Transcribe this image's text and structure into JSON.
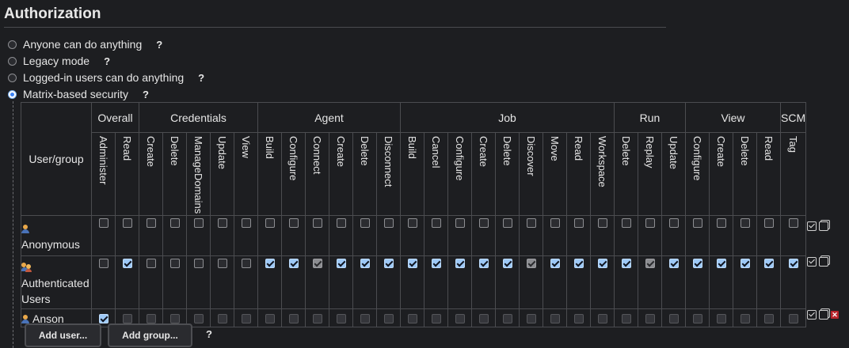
{
  "section": {
    "title": "Authorization"
  },
  "strategies": [
    {
      "label": "Anyone can do anything",
      "help": "?",
      "selected": false
    },
    {
      "label": "Legacy mode",
      "help": "?",
      "selected": false
    },
    {
      "label": "Logged-in users can do anything",
      "help": "?",
      "selected": false
    },
    {
      "label": "Matrix-based security",
      "help": "?",
      "selected": true
    }
  ],
  "matrix": {
    "user_group_header": "User/group",
    "groups": [
      {
        "label": "Overall",
        "permissions": [
          "Administer",
          "Read"
        ]
      },
      {
        "label": "Credentials",
        "permissions": [
          "Create",
          "Delete",
          "ManageDomains",
          "Update",
          "View"
        ]
      },
      {
        "label": "Agent",
        "permissions": [
          "Build",
          "Configure",
          "Connect",
          "Create",
          "Delete",
          "Disconnect"
        ]
      },
      {
        "label": "Job",
        "permissions": [
          "Build",
          "Cancel",
          "Configure",
          "Create",
          "Delete",
          "Discover",
          "Move",
          "Read",
          "Workspace"
        ]
      },
      {
        "label": "Run",
        "permissions": [
          "Delete",
          "Replay",
          "Update"
        ]
      },
      {
        "label": "View",
        "permissions": [
          "Configure",
          "Create",
          "Delete",
          "Read"
        ]
      },
      {
        "label": "SCM",
        "permissions": [
          "Tag"
        ]
      }
    ],
    "rows": [
      {
        "name": "Anonymous",
        "icon": "user-icon",
        "deletable": false,
        "states": [
          "off",
          "off",
          "off",
          "off",
          "off",
          "off",
          "off",
          "off",
          "off",
          "off",
          "off",
          "off",
          "off",
          "off",
          "off",
          "off",
          "off",
          "off",
          "off",
          "off",
          "off",
          "off",
          "off",
          "off",
          "off",
          "off",
          "off",
          "off",
          "off",
          "off"
        ]
      },
      {
        "name": "Authenticated Users",
        "icon": "group-icon",
        "deletable": false,
        "states": [
          "off",
          "on",
          "off",
          "off",
          "off",
          "off",
          "off",
          "on",
          "on",
          "imp",
          "on",
          "on",
          "on",
          "on",
          "on",
          "on",
          "on",
          "on",
          "imp",
          "on",
          "on",
          "on",
          "on",
          "imp",
          "on",
          "on",
          "on",
          "on",
          "on",
          "on"
        ]
      },
      {
        "name": "Anson",
        "icon": "user-icon",
        "deletable": true,
        "states": [
          "on",
          "dim",
          "dim",
          "dim",
          "dim",
          "dim",
          "dim",
          "dim",
          "dim",
          "dim",
          "dim",
          "dim",
          "dim",
          "dim",
          "dim",
          "dim",
          "dim",
          "dim",
          "dim",
          "dim",
          "dim",
          "dim",
          "dim",
          "dim",
          "dim",
          "dim",
          "dim",
          "dim",
          "dim",
          "dim"
        ]
      }
    ]
  },
  "buttons": {
    "add_user": "Add user...",
    "add_group": "Add group...",
    "help": "?"
  },
  "icons": {
    "select_all": "select-all-icon",
    "unselect_all": "unselect-all-icon",
    "remove": "remove-icon"
  },
  "colors": {
    "background": "#1d1e21",
    "checked": "#9ec9f7",
    "remove": "#b8242b"
  }
}
